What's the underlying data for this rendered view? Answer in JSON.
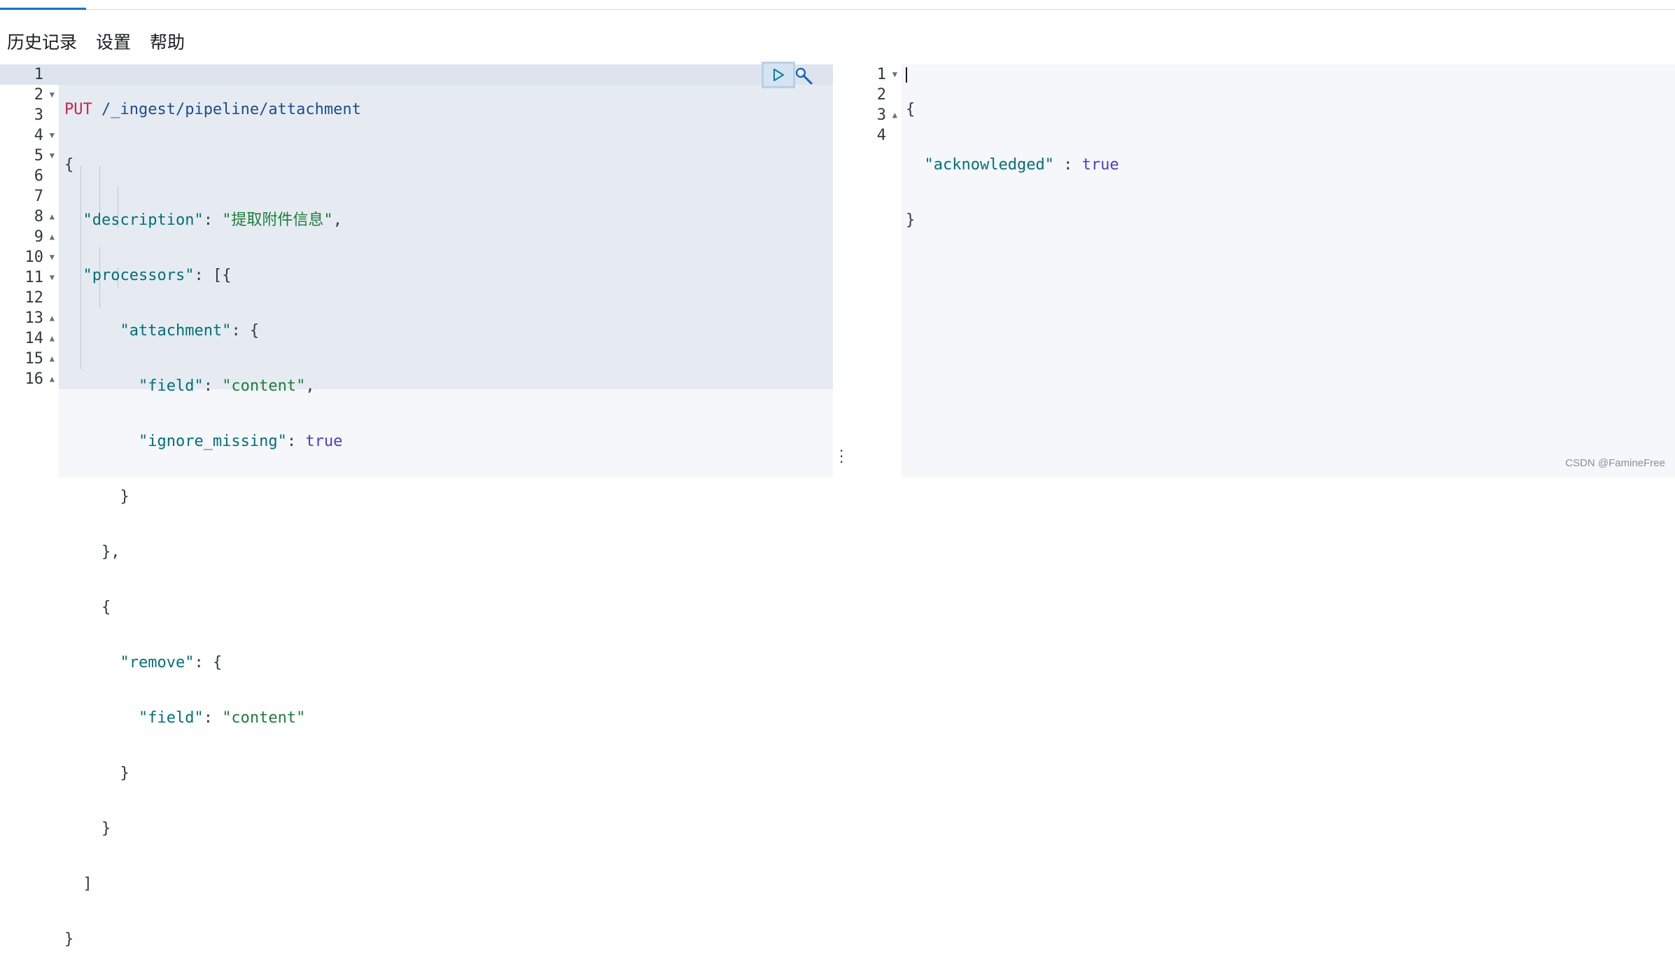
{
  "menu": {
    "items": [
      "历史记录",
      "设置",
      "帮助"
    ]
  },
  "request": {
    "line_numbers": [
      "1",
      "2",
      "3",
      "4",
      "5",
      "6",
      "7",
      "8",
      "9",
      "10",
      "11",
      "12",
      "13",
      "14",
      "15",
      "16"
    ],
    "method": "PUT",
    "path": " /_ingest/pipeline/attachment",
    "keys": {
      "description": "\"description\"",
      "processors": "\"processors\"",
      "attachment": "\"attachment\"",
      "field": "\"field\"",
      "ignore_missing": "\"ignore_missing\"",
      "remove": "\"remove\""
    },
    "values": {
      "description": "\"提取附件信息\"",
      "content": "\"content\"",
      "true": "true"
    }
  },
  "response": {
    "line_numbers": [
      "1",
      "2",
      "3",
      "4"
    ],
    "key": "\"acknowledged\"",
    "value": "true"
  },
  "icons": {
    "run": "play-icon",
    "settings": "wrench-icon",
    "resize": "vertical-dots-icon"
  },
  "watermark": "CSDN @FamineFree",
  "colors": {
    "accent": "#0077cc",
    "method": "#c7254e",
    "key": "#00707a",
    "string": "#1a7f37",
    "boolean": "#4c3bcf"
  }
}
